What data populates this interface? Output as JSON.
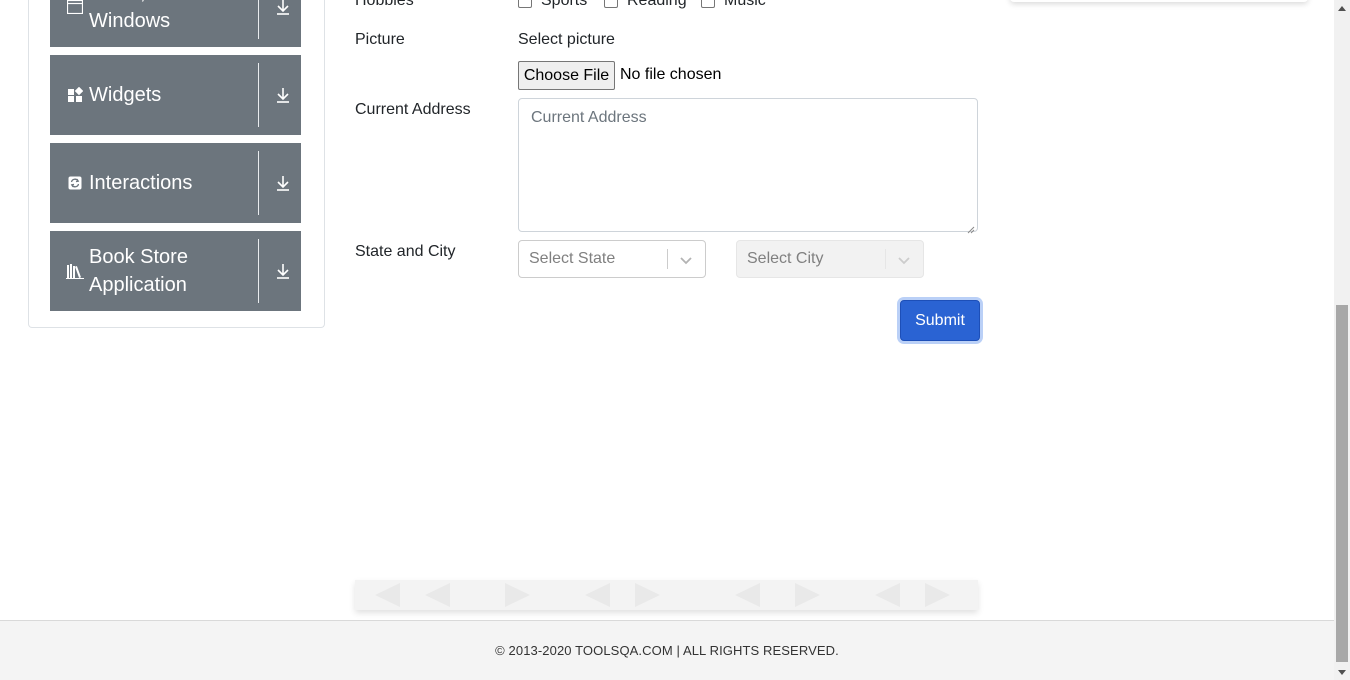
{
  "sidebar": {
    "groups": [
      {
        "label": "Alerts, Frame & Windows",
        "icon": "window-icon"
      },
      {
        "label": "Widgets",
        "icon": "widgets-icon"
      },
      {
        "label": "Interactions",
        "icon": "interactions-icon"
      },
      {
        "label": "Book Store Application",
        "icon": "books-icon"
      }
    ]
  },
  "form": {
    "hobbies_label": "Hobbies",
    "hobbies": [
      "Sports",
      "Reading",
      "Music"
    ],
    "picture_label": "Picture",
    "picture_hint": "Select picture",
    "file_button": "Choose File",
    "file_status": "No file chosen",
    "address_label": "Current Address",
    "address_placeholder": "Current Address",
    "state_city_label": "State and City",
    "state_placeholder": "Select State",
    "city_placeholder": "Select City",
    "submit_label": "Submit"
  },
  "footer": {
    "copyright": "© 2013-2020 TOOLSQA.COM | ALL RIGHTS RESERVED."
  },
  "colors": {
    "sidebar_group": "#6c757d",
    "submit": "#2a63d3",
    "footer_bg": "#f4f4f4"
  }
}
